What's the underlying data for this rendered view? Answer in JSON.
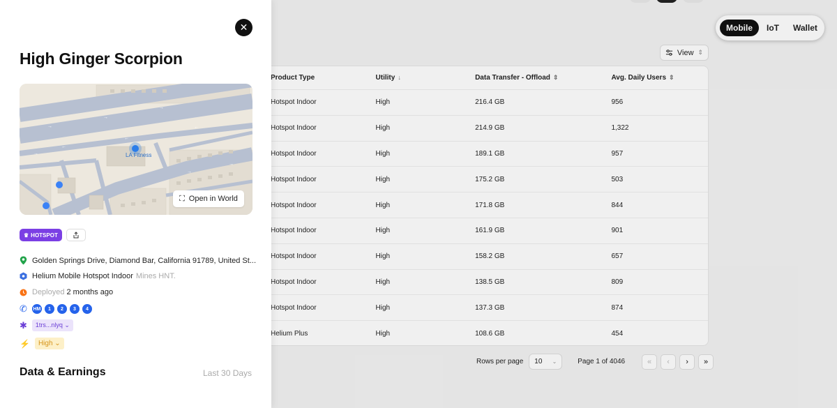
{
  "network_toggle": {
    "options": [
      "Mobile",
      "IoT",
      "Wallet"
    ],
    "active": "Mobile"
  },
  "view_button": {
    "label": "View"
  },
  "table": {
    "headers": [
      "Product Type",
      "Utility",
      "Data Transfer - Offload",
      "Avg. Daily Users"
    ],
    "rows": [
      [
        "Hotspot Indoor",
        "High",
        "216.4 GB",
        "956"
      ],
      [
        "Hotspot Indoor",
        "High",
        "214.9 GB",
        "1,322"
      ],
      [
        "Hotspot Indoor",
        "High",
        "189.1 GB",
        "957"
      ],
      [
        "Hotspot Indoor",
        "High",
        "175.2 GB",
        "503"
      ],
      [
        "Hotspot Indoor",
        "High",
        "171.8 GB",
        "844"
      ],
      [
        "Hotspot Indoor",
        "High",
        "161.9 GB",
        "901"
      ],
      [
        "Hotspot Indoor",
        "High",
        "158.2 GB",
        "657"
      ],
      [
        "Hotspot Indoor",
        "High",
        "138.5 GB",
        "809"
      ],
      [
        "Hotspot Indoor",
        "High",
        "137.3 GB",
        "874"
      ],
      [
        "Helium Plus",
        "High",
        "108.6 GB",
        "454"
      ]
    ]
  },
  "pagination": {
    "rows_per_page_label": "Rows per page",
    "rows_per_page": "10",
    "page_label": "Page 1 of 4046"
  },
  "panel": {
    "title": "High Ginger Scorpion",
    "map": {
      "place_label": "LA Fitness",
      "open_world_label": "Open in World"
    },
    "hotspot_badge": "HOTSPOT",
    "address": "Golden Springs Drive, Diamond Bar, California 91789, United St...",
    "device_type": "Helium Mobile Hotspot Indoor",
    "device_note": "Mines HNT.",
    "deployed_label": "Deployed",
    "deployed_value": "2 months ago",
    "radio_chips": [
      "HM",
      "1",
      "2",
      "3",
      "4"
    ],
    "owner": "1trs...nlyq",
    "utility_tag": "High",
    "section_title": "Data & Earnings",
    "section_period": "Last 30 Days"
  },
  "colors": {
    "hotspot": "#7b3fe4",
    "chip_blue": "#2563eb",
    "address_pin": "#22a34a",
    "deployed_clock": "#f97316",
    "utility_bolt": "#f5a623"
  }
}
